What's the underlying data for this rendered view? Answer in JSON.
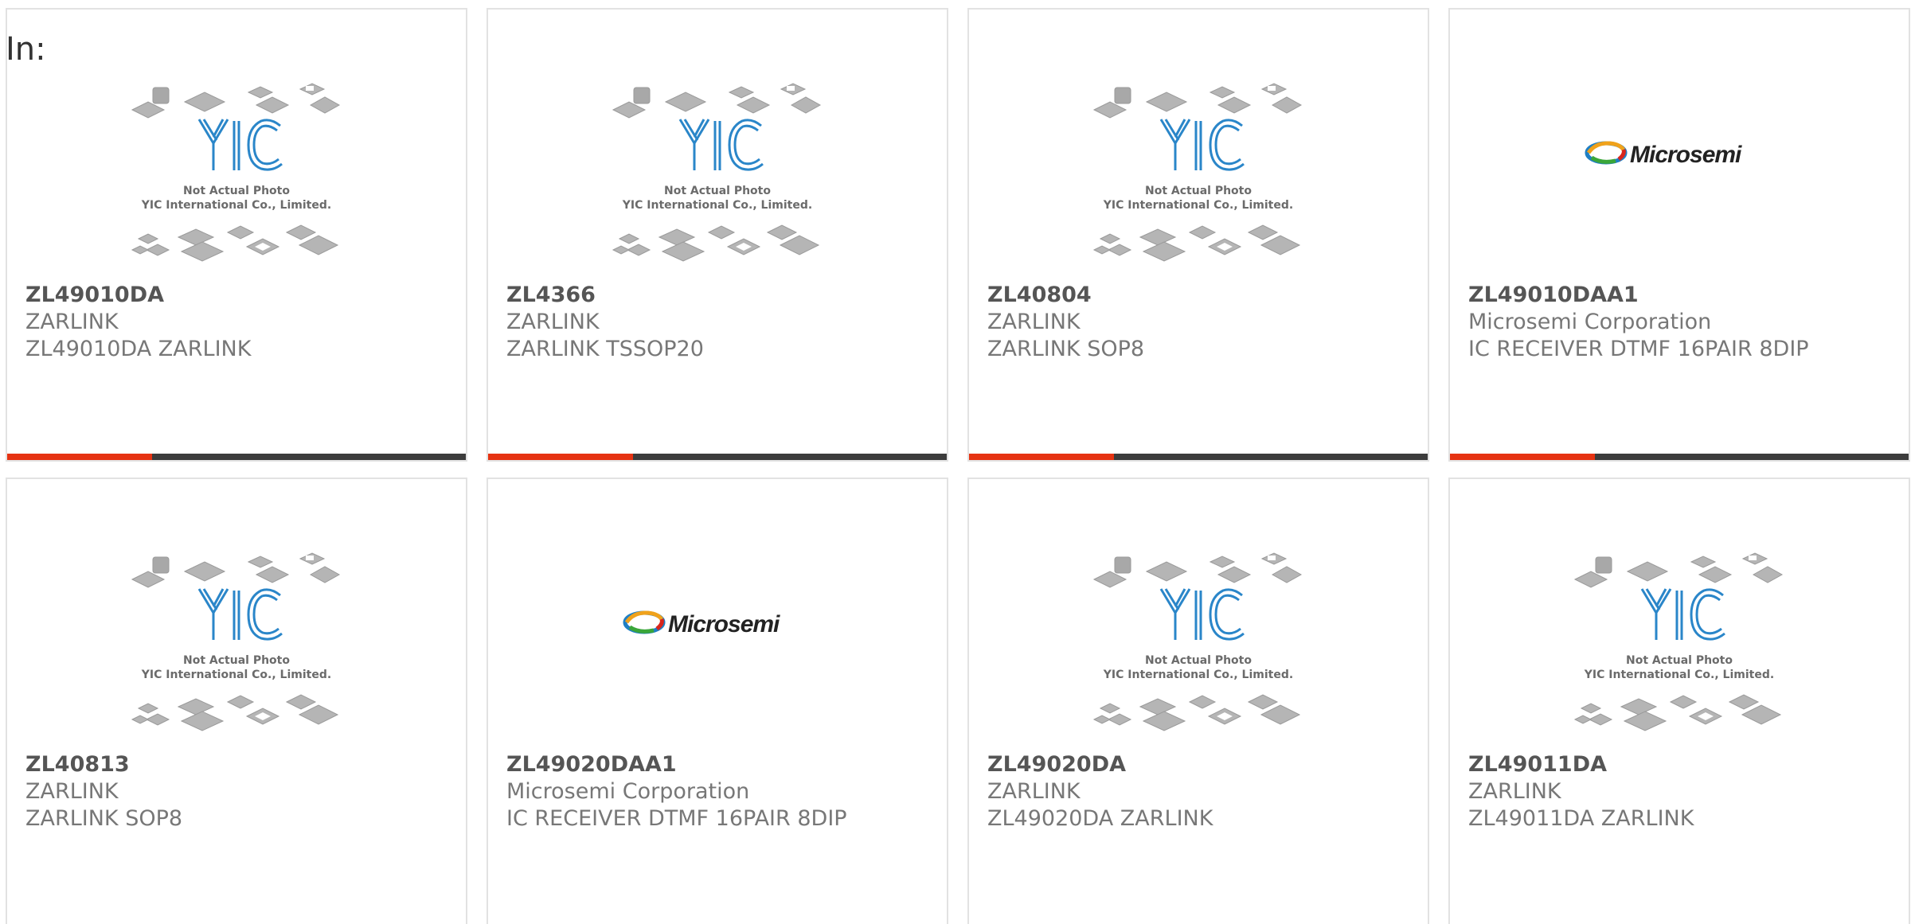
{
  "header": {
    "in_label": "In:"
  },
  "colors": {
    "accent": "#e63312",
    "bar": "#3c3c3c",
    "yic_blue": "#2a86c9"
  },
  "placeholder": {
    "line1": "Not Actual Photo",
    "line2": "YIC International Co., Limited.",
    "logo_text": "YIC"
  },
  "microsemi": {
    "logo_text": "Microsemi"
  },
  "products": [
    {
      "part": "ZL49010DA",
      "manufacturer": "ZARLINK",
      "description": "ZL49010DA ZARLINK",
      "image": "yic-placeholder"
    },
    {
      "part": "ZL4366",
      "manufacturer": "ZARLINK",
      "description": "ZARLINK TSSOP20",
      "image": "yic-placeholder"
    },
    {
      "part": "ZL40804",
      "manufacturer": "ZARLINK",
      "description": "ZARLINK SOP8",
      "image": "yic-placeholder"
    },
    {
      "part": "ZL49010DAA1",
      "manufacturer": "Microsemi Corporation",
      "description": "IC RECEIVER DTMF 16PAIR 8DIP",
      "image": "microsemi-logo"
    },
    {
      "part": "ZL40813",
      "manufacturer": "ZARLINK",
      "description": "ZARLINK SOP8",
      "image": "yic-placeholder"
    },
    {
      "part": "ZL49020DAA1",
      "manufacturer": "Microsemi Corporation",
      "description": "IC RECEIVER DTMF 16PAIR 8DIP",
      "image": "microsemi-logo"
    },
    {
      "part": "ZL49020DA",
      "manufacturer": "ZARLINK",
      "description": "ZL49020DA ZARLINK",
      "image": "yic-placeholder"
    },
    {
      "part": "ZL49011DA",
      "manufacturer": "ZARLINK",
      "description": "ZL49011DA ZARLINK",
      "image": "yic-placeholder"
    }
  ]
}
